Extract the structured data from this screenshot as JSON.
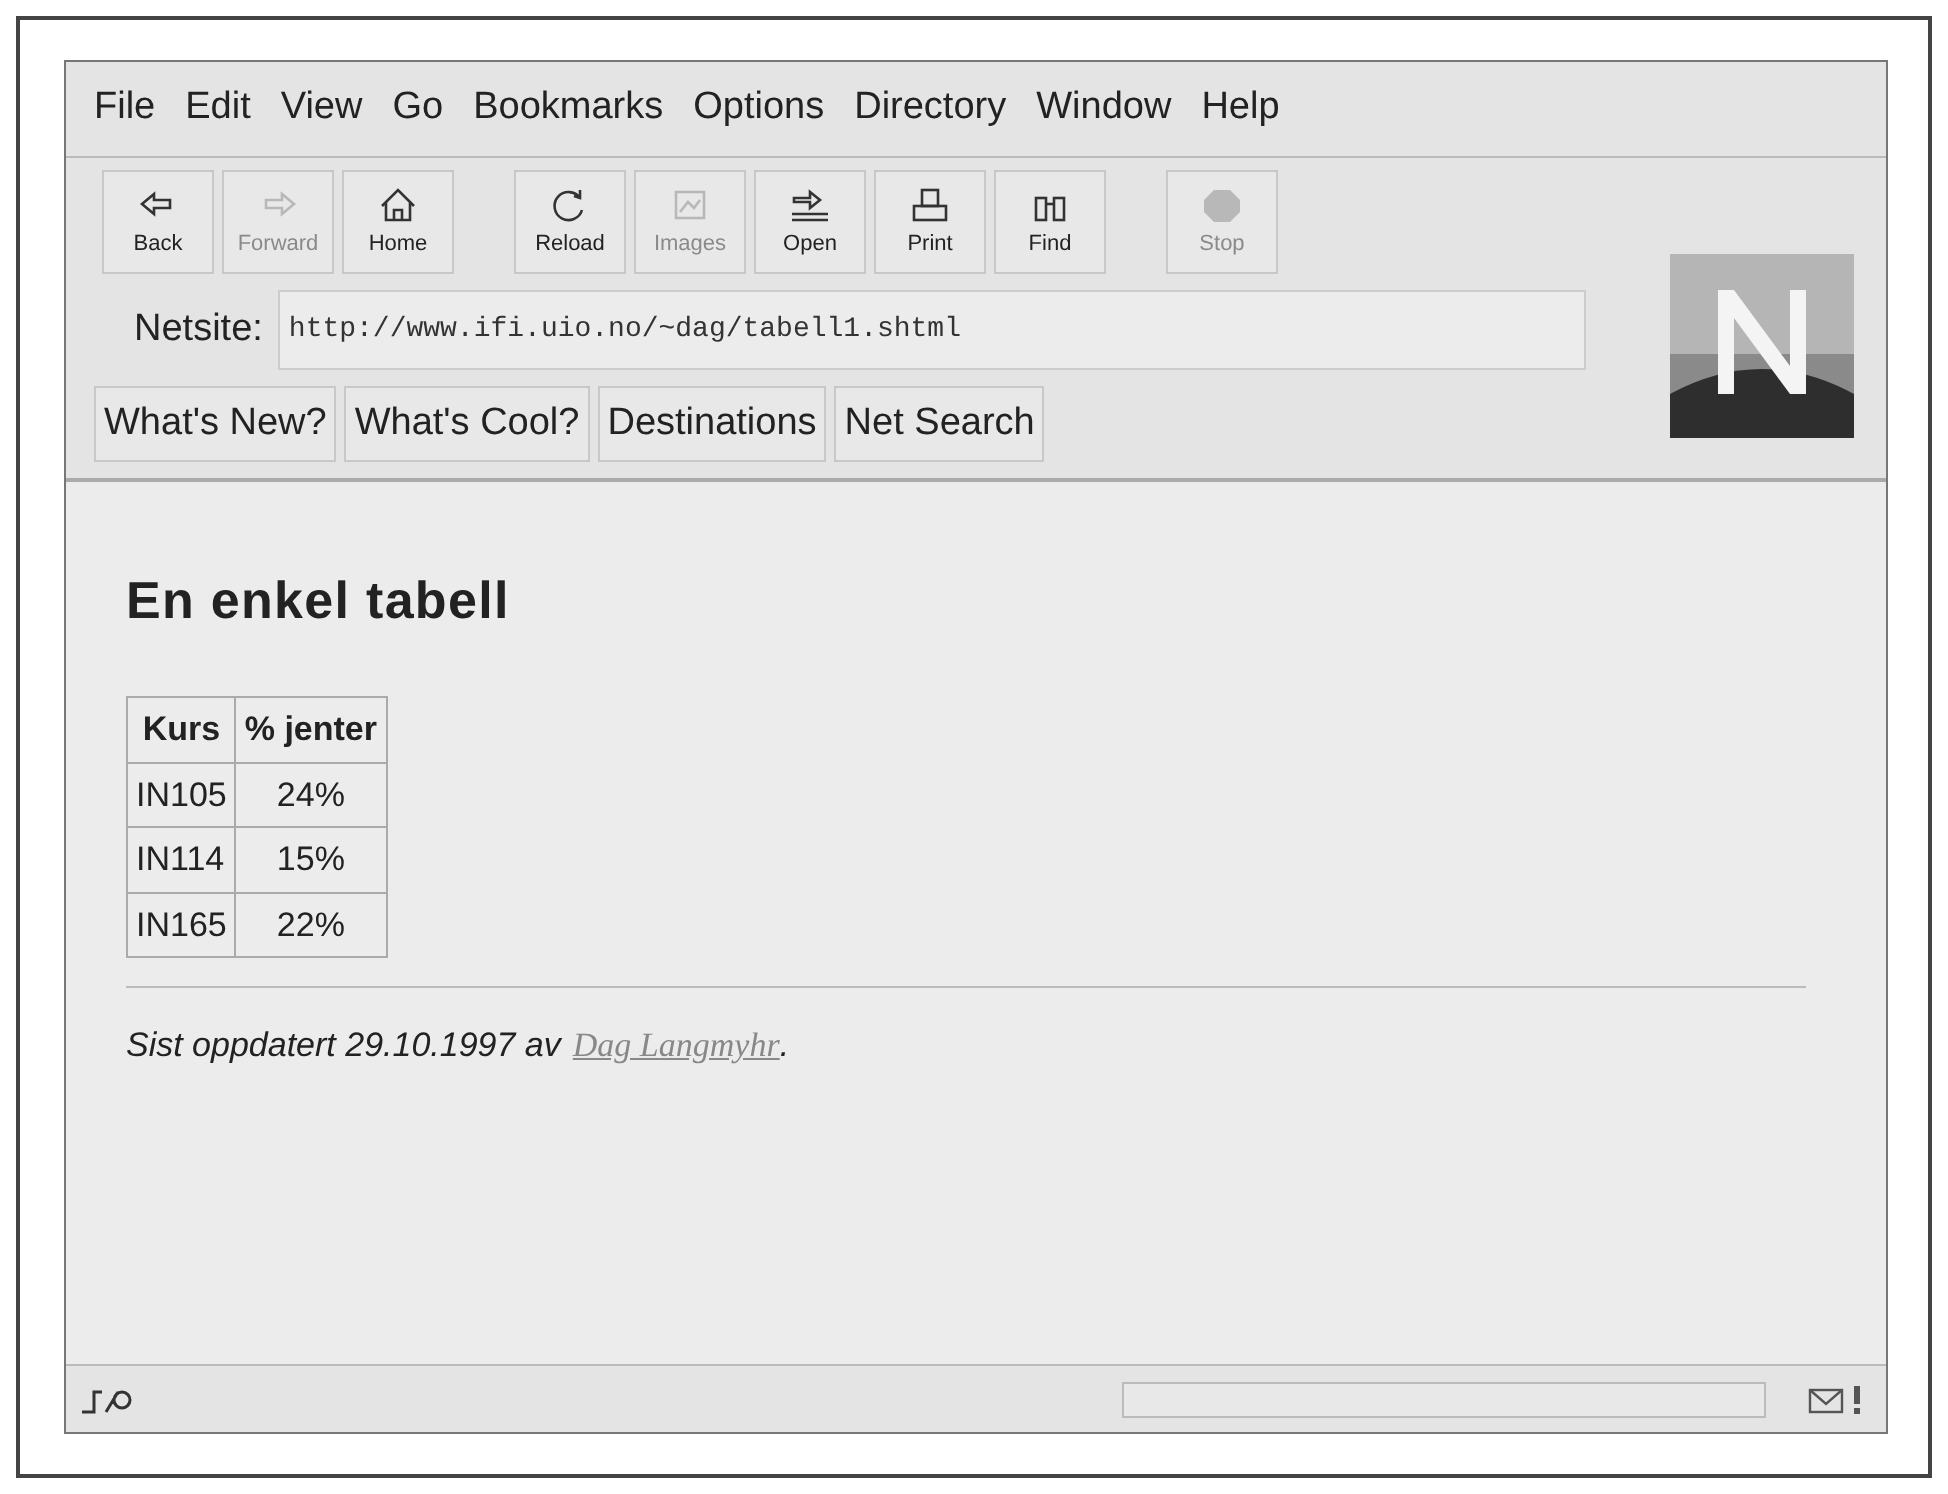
{
  "menu": [
    "File",
    "Edit",
    "View",
    "Go",
    "Bookmarks",
    "Options",
    "Directory",
    "Window",
    "Help"
  ],
  "toolbar": [
    {
      "label": "Back",
      "kind": "back",
      "disabled": false
    },
    {
      "label": "Forward",
      "kind": "forward",
      "disabled": true
    },
    {
      "label": "Home",
      "kind": "home",
      "disabled": false
    },
    {
      "label": "Reload",
      "kind": "reload",
      "disabled": false
    },
    {
      "label": "Images",
      "kind": "images",
      "disabled": true
    },
    {
      "label": "Open",
      "kind": "open",
      "disabled": false
    },
    {
      "label": "Print",
      "kind": "print",
      "disabled": false
    },
    {
      "label": "Find",
      "kind": "find",
      "disabled": false
    },
    {
      "label": "Stop",
      "kind": "stop",
      "disabled": true
    }
  ],
  "location": {
    "label": "Netsite:",
    "value": "http://www.ifi.uio.no/~dag/tabell1.shtml"
  },
  "directory_buttons": [
    "What's New?",
    "What's Cool?",
    "Destinations",
    "Net Search"
  ],
  "page": {
    "heading": "En enkel tabell",
    "table": {
      "columns": [
        "Kurs",
        "% jenter"
      ],
      "rows": [
        [
          "IN105",
          "24%"
        ],
        [
          "IN114",
          "15%"
        ],
        [
          "IN165",
          "22%"
        ]
      ]
    },
    "footer": {
      "text": "Sist oppdatert 29.10.1997 av",
      "link": "Dag Langmyhr",
      "end": "."
    }
  }
}
